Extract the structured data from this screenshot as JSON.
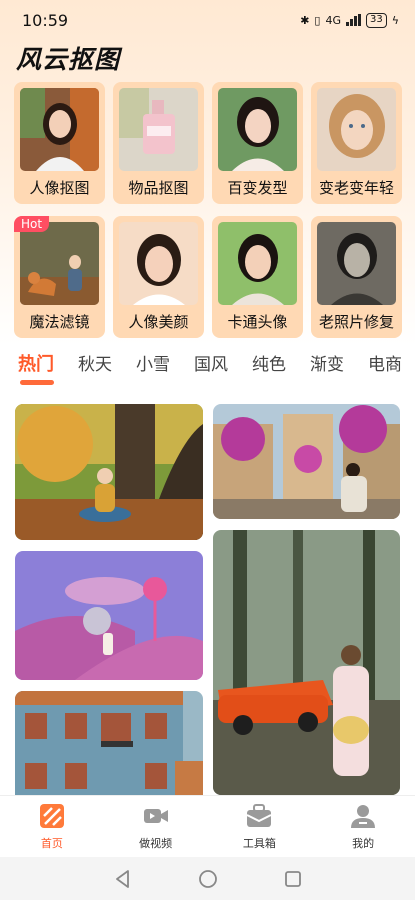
{
  "status_bar": {
    "time": "10:59",
    "network": "4G",
    "battery": "33"
  },
  "app": {
    "title": "风云抠图"
  },
  "features": [
    {
      "label": "人像抠图",
      "icon": "portrait-cutout-thumbnail",
      "hot": false
    },
    {
      "label": "物品抠图",
      "icon": "perfume-bottle-thumbnail",
      "hot": false
    },
    {
      "label": "百变发型",
      "icon": "hairstyle-thumbnail",
      "hot": false
    },
    {
      "label": "变老变年轻",
      "icon": "child-face-thumbnail",
      "hot": false
    },
    {
      "label": "魔法滤镜",
      "icon": "girl-with-fox-thumbnail",
      "hot": true,
      "badge": "Hot"
    },
    {
      "label": "人像美颜",
      "icon": "beauty-portrait-thumbnail",
      "hot": false
    },
    {
      "label": "卡通头像",
      "icon": "cartoon-avatar-thumbnail",
      "hot": false
    },
    {
      "label": "老照片修复",
      "icon": "old-photo-thumbnail",
      "hot": false
    }
  ],
  "tabs": [
    {
      "label": "热门",
      "active": true
    },
    {
      "label": "秋天",
      "active": false
    },
    {
      "label": "小雪",
      "active": false
    },
    {
      "label": "国风",
      "active": false
    },
    {
      "label": "纯色",
      "active": false
    },
    {
      "label": "渐变",
      "active": false
    },
    {
      "label": "电商",
      "active": false
    }
  ],
  "feed": [
    {
      "name": "autumn-reading-photo"
    },
    {
      "name": "flower-village-photo"
    },
    {
      "name": "purple-fantasy-photo"
    },
    {
      "name": "forest-red-car-photo"
    },
    {
      "name": "blue-building-photo"
    }
  ],
  "bottom_nav": [
    {
      "label": "首页",
      "icon": "home-icon",
      "active": true
    },
    {
      "label": "做视频",
      "icon": "video-camera-icon",
      "active": false
    },
    {
      "label": "工具箱",
      "icon": "toolbox-icon",
      "active": false
    },
    {
      "label": "我的",
      "icon": "user-profile-icon",
      "active": false
    }
  ],
  "colors": {
    "accent": "#ff5a2a",
    "card_bg": "#ffd9b4",
    "hot_badge": "#ff4e62"
  }
}
